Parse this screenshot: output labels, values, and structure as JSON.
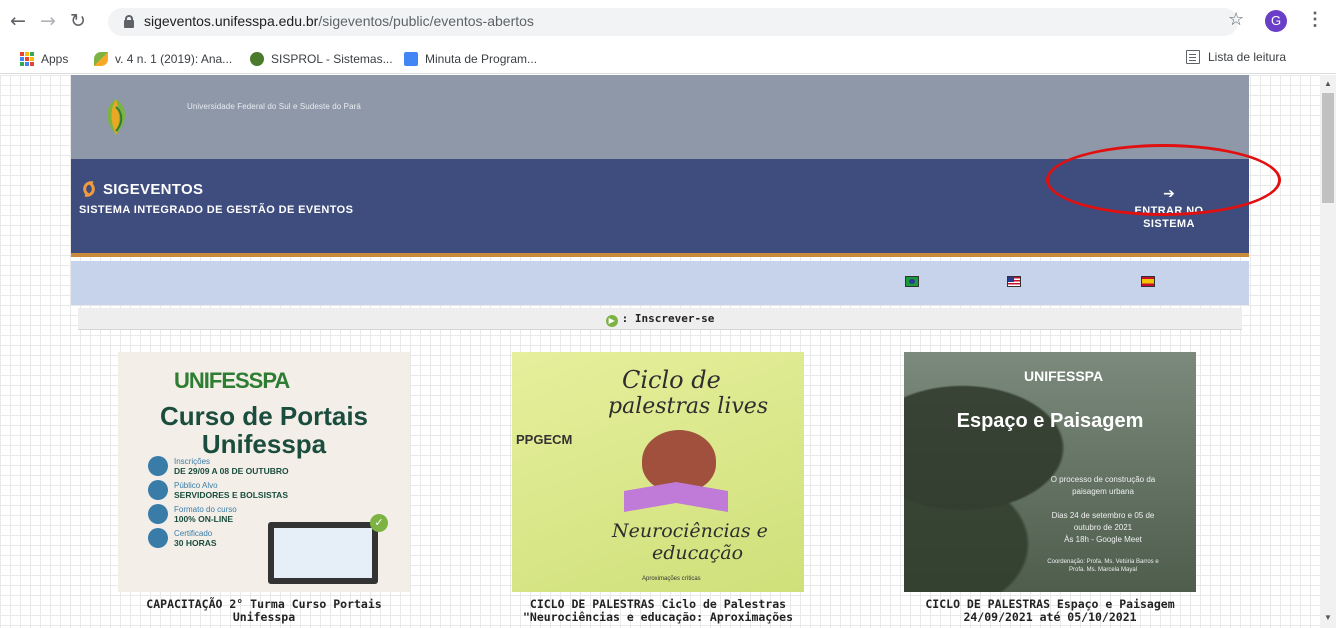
{
  "browser": {
    "url_host": "sigeventos.unifesspa.edu.br",
    "url_path": "/sigeventos/public/eventos-abertos",
    "profile_initial": "G",
    "bookmarks": [
      {
        "label": "Apps"
      },
      {
        "label": "v. 4 n. 1 (2019): Ana..."
      },
      {
        "label": "SISPROL - Sistemas..."
      },
      {
        "label": "Minuta de Program..."
      }
    ],
    "reading_list": "Lista de leitura"
  },
  "header": {
    "institution": "Universidade Federal do Sul e Sudeste do Pará",
    "system_name": "SIGEVENTOS",
    "system_full_name": "SISTEMA INTEGRADO DE GESTÃO DE EVENTOS",
    "login_label_1": "ENTRAR NO",
    "login_label_2": "SISTEMA"
  },
  "subscribe_label": ": Inscrever-se",
  "events": [
    {
      "title_1": "CAPACITAÇÃO 2° Turma Curso Portais",
      "title_2": "Unifesspa",
      "poster": {
        "brand": "UNIFESSPA",
        "heading_1": "Curso de Portais",
        "heading_2": "Unifesspa",
        "rows": [
          {
            "label": "Inscrições",
            "value": "DE 29/09 A 08 DE OUTUBRO"
          },
          {
            "label": "Público Alvo",
            "value": "SERVIDORES E BOLSISTAS"
          },
          {
            "label": "Formato do curso",
            "value": "100% ON-LINE"
          },
          {
            "label": "Certificado",
            "value": "30 HORAS"
          }
        ]
      }
    },
    {
      "title_1": "CICLO DE PALESTRAS Ciclo de Palestras",
      "title_2": "\"Neurociências e educação: Aproximações",
      "poster": {
        "line_1": "Ciclo de",
        "line_2": "palestras lives",
        "line_3": "Neurociências e",
        "line_4": "educação",
        "tagline": "Aproximações críticas",
        "org": "PPGECM"
      }
    },
    {
      "title_1": "CICLO DE PALESTRAS Espaço e Paisagem",
      "title_2": "24/09/2021 até 05/10/2021",
      "poster": {
        "brand": "UNIFESSPA",
        "heading": "Espaço e Paisagem",
        "sub_1": "O processo de construção da",
        "sub_2": "paisagem urbana",
        "dates_1": "Dias 24 de setembro e 05 de",
        "dates_2": "outubro de 2021",
        "dates_3": "Às 18h - Google Meet",
        "coord_1": "Coordenação: Profa. Ms. Vetúria Barros e",
        "coord_2": "Profa. Ms. Marcela Mayal"
      }
    }
  ],
  "colors": {
    "institution_bar": "#8e98a8",
    "system_bar": "#3f4d7e",
    "language_bar": "#c6d3ea",
    "highlight_ellipse": "#e01010"
  }
}
